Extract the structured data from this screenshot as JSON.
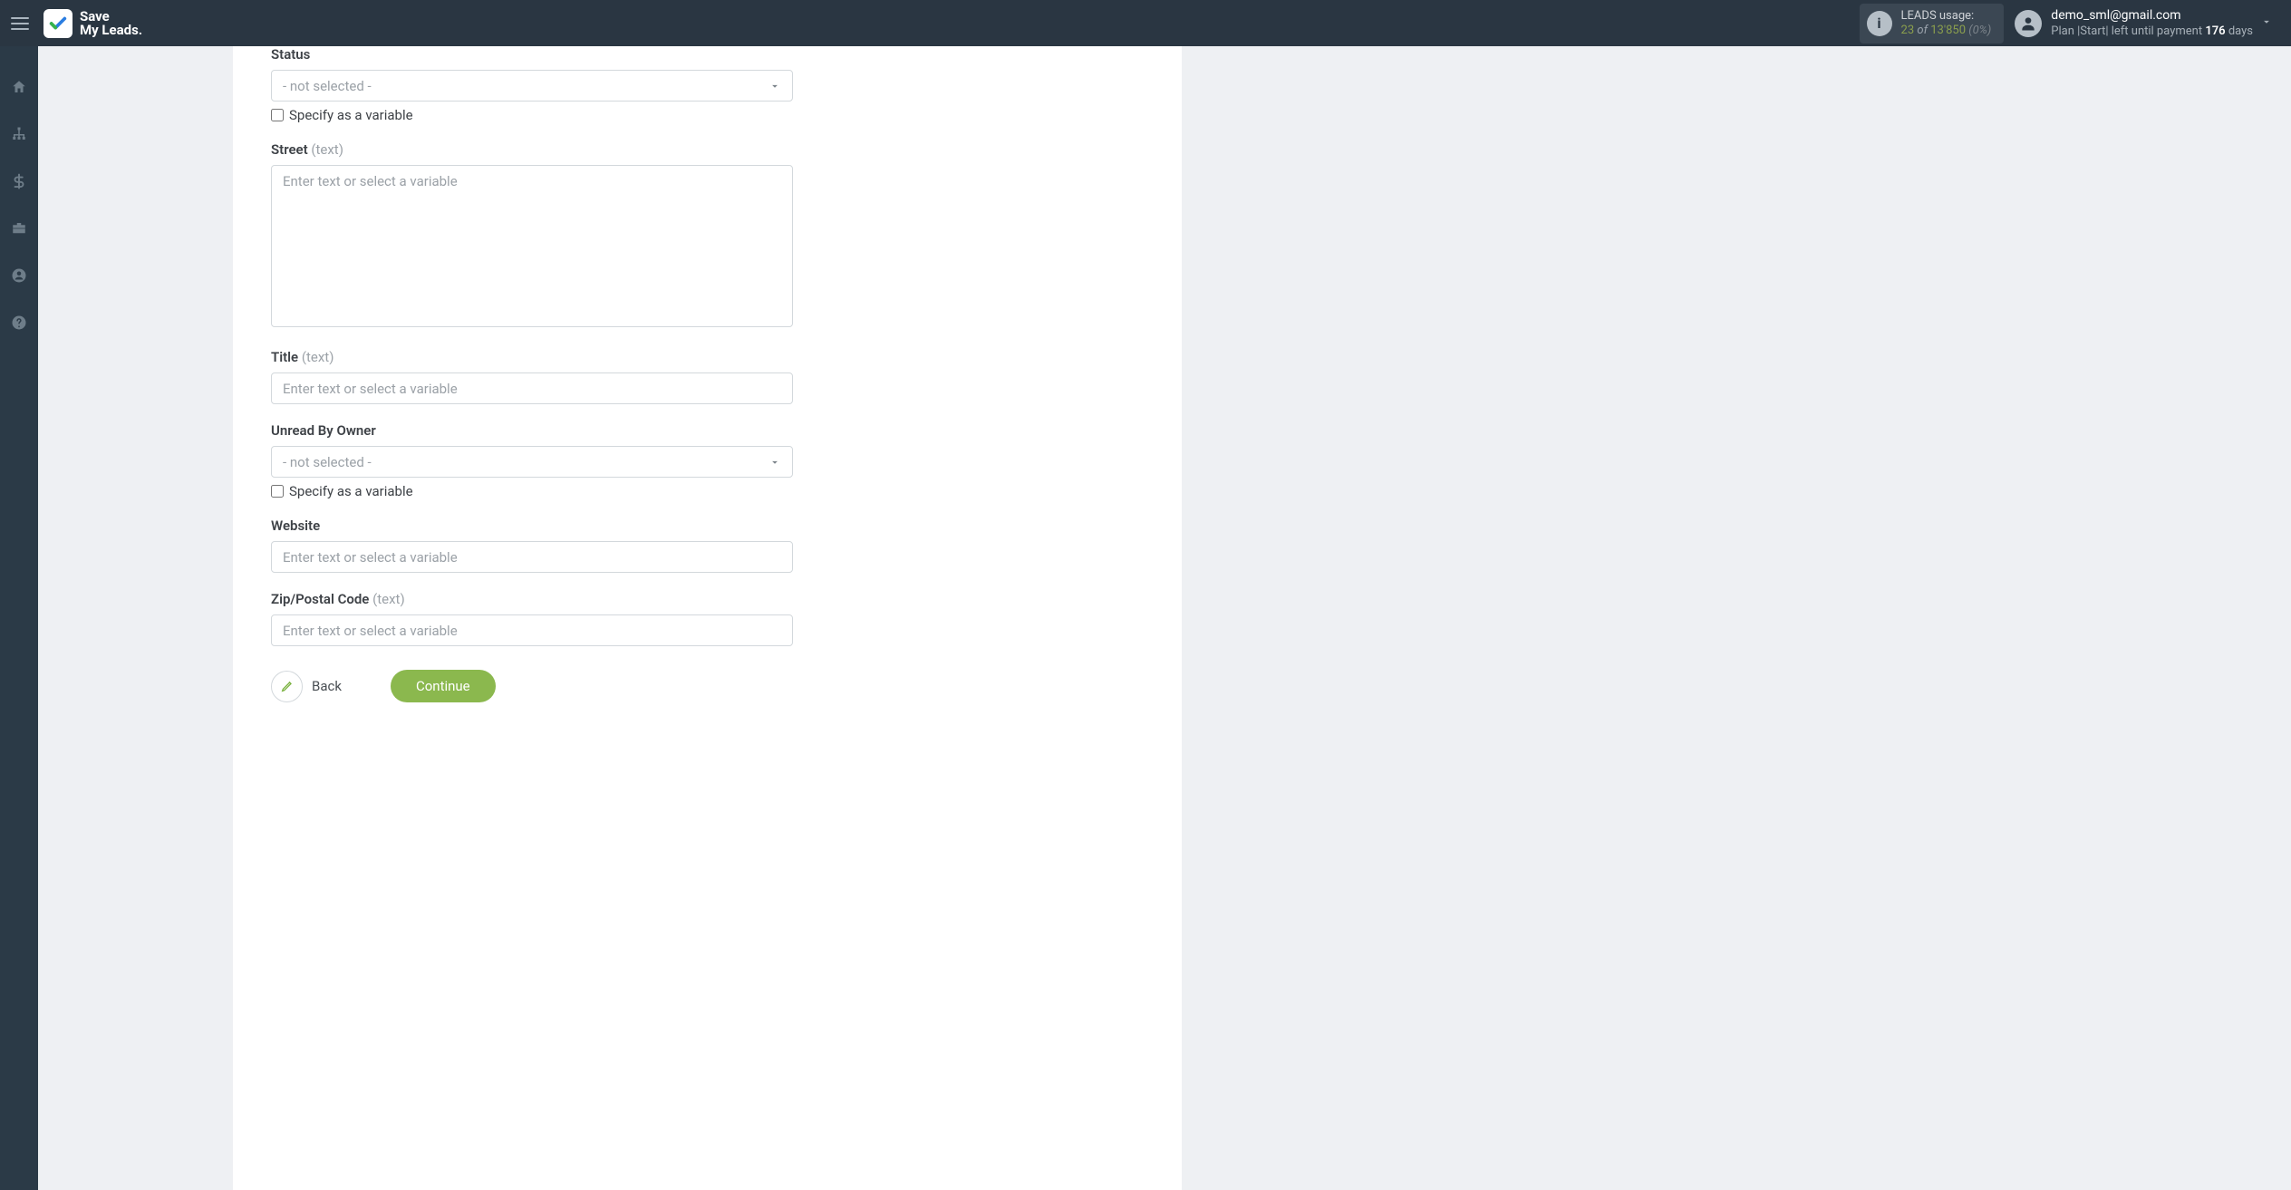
{
  "brand": {
    "line1": "Save",
    "line2": "My Leads."
  },
  "usage": {
    "title": "LEADS usage:",
    "used": "23",
    "of_word": "of",
    "total": "13'850",
    "pct": "(0%)"
  },
  "account": {
    "email": "demo_sml@gmail.com",
    "plan_prefix": "Plan |Start| left until payment ",
    "days_num": "176",
    "days_word": " days"
  },
  "form": {
    "status": {
      "label": "Status",
      "select_value": "- not selected -",
      "variable_label": "Specify as a variable"
    },
    "street": {
      "label": "Street",
      "hint": "(text)",
      "placeholder": "Enter text or select a variable"
    },
    "title_f": {
      "label": "Title",
      "hint": "(text)",
      "placeholder": "Enter text or select a variable"
    },
    "unread": {
      "label": "Unread By Owner",
      "select_value": "- not selected -",
      "variable_label": "Specify as a variable"
    },
    "website": {
      "label": "Website",
      "placeholder": "Enter text or select a variable"
    },
    "zip": {
      "label": "Zip/Postal Code",
      "hint": "(text)",
      "placeholder": "Enter text or select a variable"
    }
  },
  "buttons": {
    "back": "Back",
    "continue": "Continue"
  }
}
